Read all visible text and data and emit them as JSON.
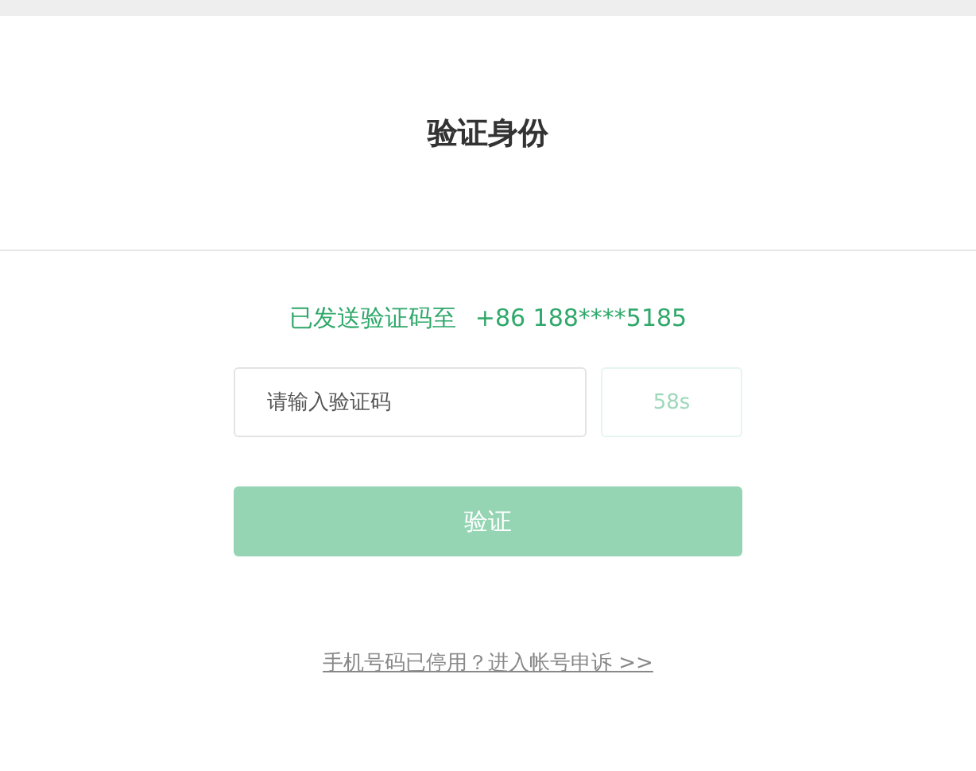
{
  "title": "验证身份",
  "sent_notice": {
    "label": "已发送验证码至",
    "phone": "+86 188****5185"
  },
  "code_field": {
    "placeholder": "请输入验证码"
  },
  "countdown": {
    "label": "58s",
    "disabled": true
  },
  "verify_button": {
    "label": "验证",
    "disabled": true
  },
  "appeal_link": "手机号码已停用？进入帐号申诉 >>"
}
